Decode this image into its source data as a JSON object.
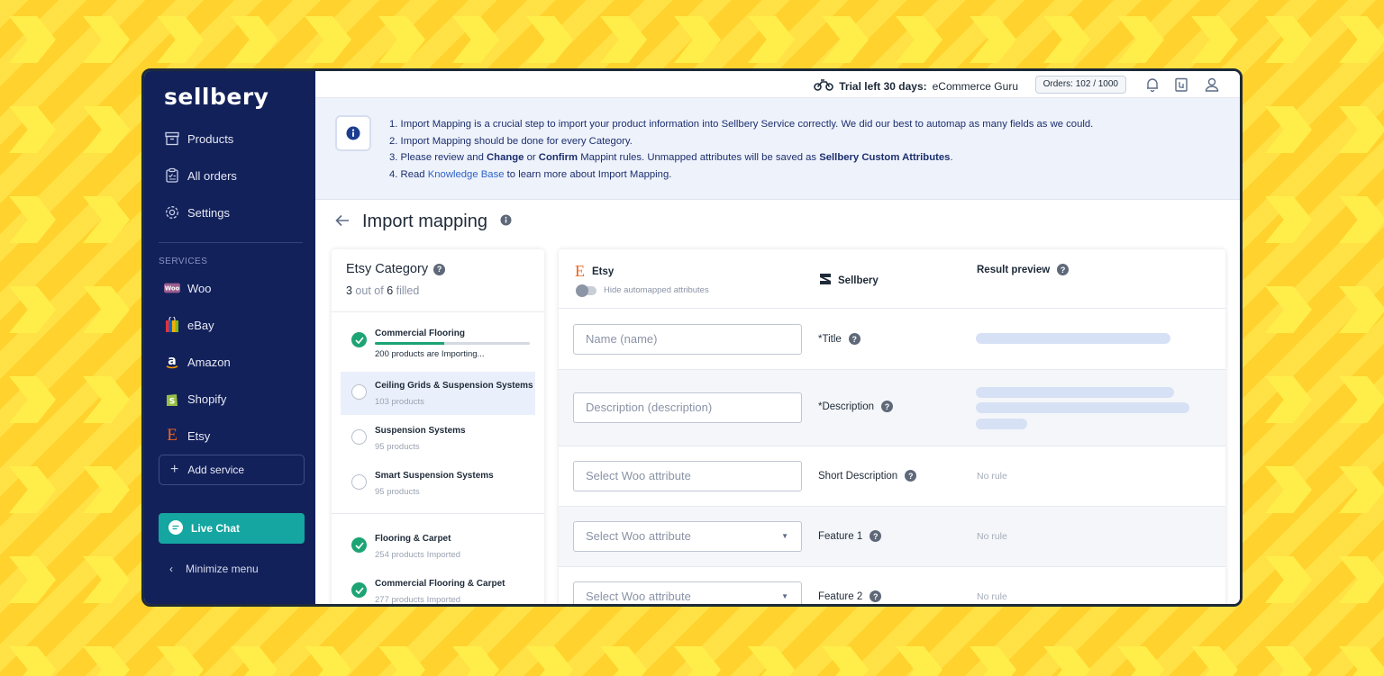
{
  "app": {
    "logo": "sellbery",
    "nav": [
      {
        "label": "Products",
        "icon": "archive-box-icon"
      },
      {
        "label": "All orders",
        "icon": "clipboard-icon"
      },
      {
        "label": "Settings",
        "icon": "gear-icon"
      }
    ],
    "services_label": "SERVICES",
    "services": [
      {
        "label": "Woo",
        "icon": "woo-icon"
      },
      {
        "label": "eBay",
        "icon": "ebay-bag-icon"
      },
      {
        "label": "Amazon",
        "icon": "amazon-icon"
      },
      {
        "label": "Shopify",
        "icon": "shopify-bag-icon"
      },
      {
        "label": "Etsy",
        "icon": "etsy-icon"
      }
    ],
    "add_service": "Add service",
    "live_chat": "Live Chat",
    "minimize": "Minimize menu"
  },
  "topbar": {
    "trial_label": "Trial left 30 days:",
    "trial_plan": "eCommerce Guru",
    "orders": "Orders: 102 / 1000"
  },
  "banner": {
    "line1": "1. Import Mapping is a crucial step to import your product information into Sellbery Service correctly. We did our best to automap as many fields as we could.",
    "line2": "2. Import Mapping should be done for every Category.",
    "line3_a": "3. Please review and ",
    "line3_b": "Change",
    "line3_c": " or ",
    "line3_d": "Confirm",
    "line3_e": " Mappint rules. Unmapped attributes will be saved as ",
    "line3_f": "Sellbery Custom Attributes",
    "line3_g": ".",
    "line4_a": "4. Read ",
    "line4_link": "Knowledge Base",
    "line4_b": " to learn more about Import Mapping."
  },
  "page": {
    "title": "Import mapping"
  },
  "category": {
    "title": "Etsy Category",
    "filled_num": "3",
    "filled_mid": " out of ",
    "filled_total": "6",
    "filled_suffix": " filled",
    "items": [
      {
        "name": "Commercial Flooring",
        "status": "200 products are Importing...",
        "state": "importing",
        "progress": 0.45
      },
      {
        "name": "Ceiling Grids & Suspension Systems",
        "status": "103 products",
        "state": "selected"
      },
      {
        "name": "Suspension Systems",
        "status": "95 products",
        "state": "empty"
      },
      {
        "name": "Smart Suspension Systems",
        "status": "95 products",
        "state": "empty"
      },
      {
        "name": "Flooring & Carpet",
        "status": "254 products Imported",
        "state": "done"
      },
      {
        "name": "Commercial Flooring & Carpet",
        "status": "277 products Imported",
        "state": "done"
      }
    ]
  },
  "mapping": {
    "col_source": "Etsy",
    "toggle_label": "Hide automapped attributes",
    "col_target": "Sellbery",
    "col_preview": "Result preview",
    "rows": [
      {
        "value": "Name (name)",
        "label": "*Title",
        "preview": "skeleton1"
      },
      {
        "value": "Description (description)",
        "label": "*Description",
        "preview": "skeleton3"
      },
      {
        "value": "Select Woo attribute",
        "label": "Short Description",
        "preview": "No rule"
      },
      {
        "value": "Select Woo attribute",
        "label": "Feature 1",
        "preview": "No rule"
      },
      {
        "value": "Select Woo attribute",
        "label": "Feature 2",
        "preview": "No rule"
      }
    ]
  },
  "colors": {
    "sidebar": "#13215A",
    "accent_teal": "#15A6A1",
    "success": "#1CA474",
    "background": "#FFD22E"
  }
}
